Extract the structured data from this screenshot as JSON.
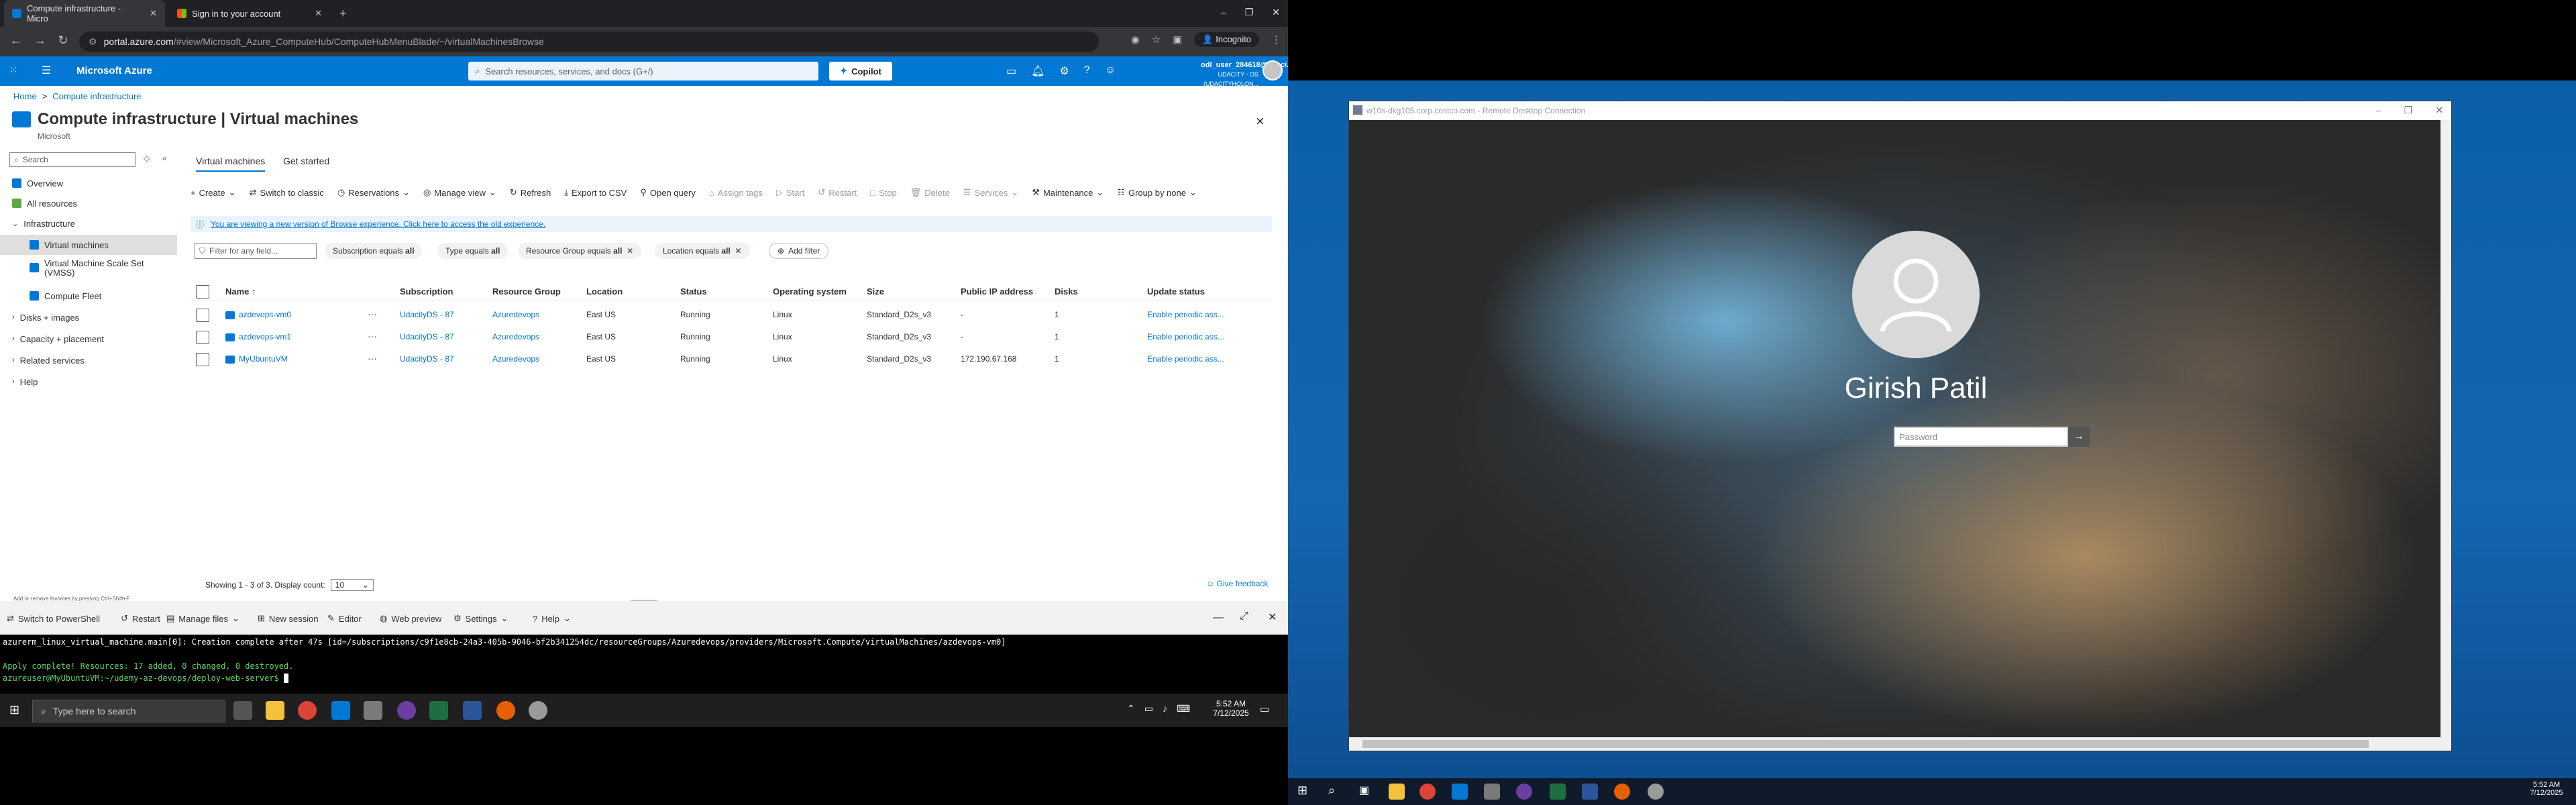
{
  "browser": {
    "tabs": [
      {
        "title": "Compute infrastructure - Micro"
      },
      {
        "title": "Sign in to your account"
      }
    ],
    "url_host": "portal.azure.com",
    "url_path": "/#view/Microsoft_Azure_ComputeHub/ComputeHubMenuBlade/~/virtualMachinesBrowse",
    "incognito_label": "Incognito"
  },
  "azure": {
    "brand": "Microsoft Azure",
    "search_placeholder": "Search resources, services, and docs (G+/)",
    "copilot_label": "Copilot",
    "user_name": "odl_user_284618@udaci...",
    "user_tenant": "UDACITY - OS (UDACITYHOLON..."
  },
  "breadcrumb": {
    "home": "Home",
    "sep": ">",
    "current": "Compute infrastructure"
  },
  "page": {
    "title": "Compute infrastructure | Virtual machines",
    "subtitle": "Microsoft",
    "more": "...",
    "close": "×"
  },
  "sidebar": {
    "search_placeholder": "Search",
    "items": [
      {
        "label": "Overview"
      },
      {
        "label": "All resources"
      },
      {
        "label": "Infrastructure"
      },
      {
        "label": "Virtual machines"
      },
      {
        "label": "Virtual Machine Scale Set"
      },
      {
        "label": "(VMSS)"
      },
      {
        "label": "Compute Fleet"
      },
      {
        "label": "Disks + images"
      },
      {
        "label": "Capacity + placement"
      },
      {
        "label": "Related services"
      },
      {
        "label": "Help"
      }
    ],
    "footer_hint": "Add or remove favorites by pressing Ctrl+Shift+F"
  },
  "tabs": {
    "vm": "Virtual machines",
    "get_started": "Get started"
  },
  "toolbar": {
    "create": "Create",
    "switch_classic": "Switch to classic",
    "reservations": "Reservations",
    "manage_view": "Manage view",
    "refresh": "Refresh",
    "export_csv": "Export to CSV",
    "open_query": "Open query",
    "assign_tags": "Assign tags",
    "start": "Start",
    "restart": "Restart",
    "stop": "Stop",
    "delete": "Delete",
    "services": "Services",
    "maintenance": "Maintenance",
    "group_by": "Group by none"
  },
  "banner": {
    "text": "You are viewing a new version of Browse experience. Click here to access the old experience."
  },
  "filters": {
    "filter_placeholder": "Filter for any field...",
    "subscription_prefix": "Subscription equals",
    "subscription_value": "all",
    "type_prefix": "Type equals",
    "type_value": "all",
    "rg_prefix": "Resource Group equals",
    "rg_value": "all",
    "location_prefix": "Location equals",
    "location_value": "all",
    "add_filter": "Add filter"
  },
  "table": {
    "headers": {
      "name": "Name ↑",
      "subscription": "Subscription",
      "rg": "Resource Group",
      "location": "Location",
      "status": "Status",
      "os": "Operating system",
      "size": "Size",
      "ip": "Public IP address",
      "disks": "Disks",
      "update": "Update status"
    },
    "rows": [
      {
        "name": "azdevops-vm0",
        "subscription": "UdacityDS - 87",
        "rg": "Azuredevops",
        "location": "East US",
        "status": "Running",
        "os": "Linux",
        "size": "Standard_D2s_v3",
        "ip": "-",
        "disks": "1",
        "update": "Enable periodic ass..."
      },
      {
        "name": "azdevops-vm1",
        "subscription": "UdacityDS - 87",
        "rg": "Azuredevops",
        "location": "East US",
        "status": "Running",
        "os": "Linux",
        "size": "Standard_D2s_v3",
        "ip": "-",
        "disks": "1",
        "update": "Enable periodic ass..."
      },
      {
        "name": "MyUbuntuVM",
        "subscription": "UdacityDS - 87",
        "rg": "Azuredevops",
        "location": "East US",
        "status": "Running",
        "os": "Linux",
        "size": "Standard_D2s_v3",
        "ip": "172.190.67.168",
        "disks": "1",
        "update": "Enable periodic ass..."
      }
    ],
    "row_more": "···"
  },
  "paging": {
    "showing": "Showing 1 - 3 of 3. Display count:",
    "count": "10",
    "feedback": "Give feedback"
  },
  "shell": {
    "switch": "Switch to PowerShell",
    "restart": "Restart",
    "manage_files": "Manage files",
    "new_session": "New session",
    "editor": "Editor",
    "web_preview": "Web preview",
    "settings": "Settings",
    "help": "Help",
    "line1": "azurerm_linux_virtual_machine.main[0]: Creation complete after 47s [id=/subscriptions/c9f1e8cb-24a3-405b-9046-bf2b341254dc/resourceGroups/Azuredevops/providers/Microsoft.Compute/virtualMachines/azdevops-vm0]",
    "line2": "Apply complete! Resources: 17 added, 0 changed, 0 destroyed.",
    "prompt": "azureuser@MyUbuntuVM:~/udemy-az-devops/deploy-web-server$ "
  },
  "taskbar_left": {
    "search": "Type here to search",
    "time": "5:52 AM",
    "date": "7/12/2025"
  },
  "rdp": {
    "title": "w10s-dkg105.corp.costco.com - Remote Desktop Connection",
    "user": "Girish Patil",
    "password_placeholder": "Password",
    "time": "5:52 AM",
    "date": "7/12/2025"
  },
  "colors": {
    "azure_blue": "#0078d4",
    "chrome_dark": "#202124",
    "desktop_blue": "#0b5fa8"
  }
}
